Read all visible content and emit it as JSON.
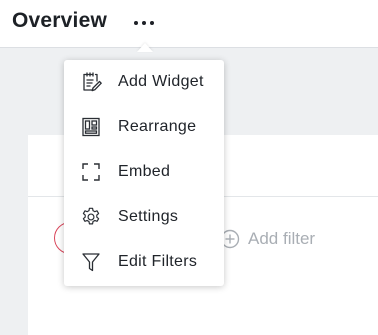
{
  "header": {
    "title": "Overview"
  },
  "add_filter": {
    "label": "Add filter",
    "icon": "plus-circle-icon"
  },
  "menu": {
    "items": [
      {
        "label": "Add Widget",
        "icon": "add-widget-icon"
      },
      {
        "label": "Rearrange",
        "icon": "rearrange-icon"
      },
      {
        "label": "Embed",
        "icon": "embed-icon"
      },
      {
        "label": "Settings",
        "icon": "gear-icon"
      },
      {
        "label": "Edit Filters",
        "icon": "filter-icon"
      }
    ]
  },
  "colors": {
    "accent_red": "#d9455a",
    "placeholder_gray": "#a9aeb4",
    "text": "#20242a"
  }
}
